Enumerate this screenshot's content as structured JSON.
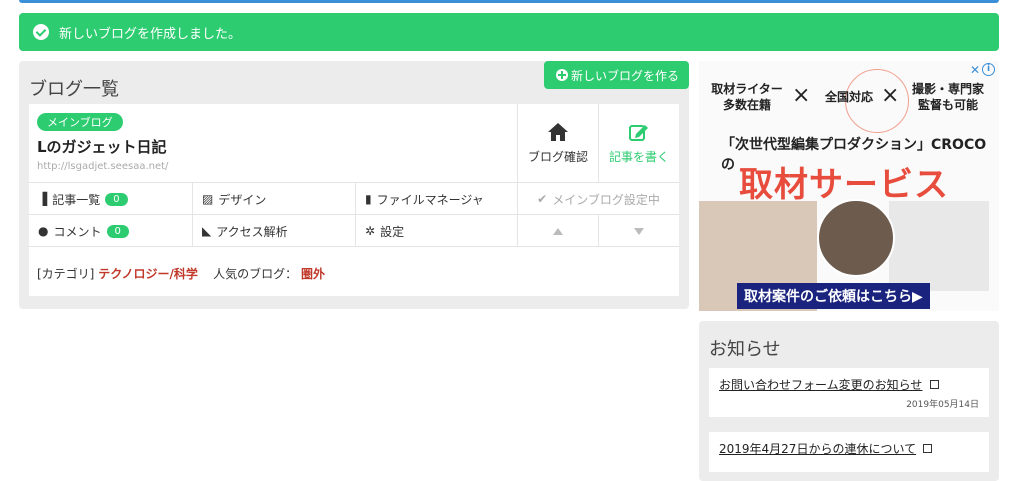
{
  "alert": {
    "message": "新しいブログを作成しました。"
  },
  "panel": {
    "title": "ブログ一覧",
    "new_blog_button": "新しいブログを作る"
  },
  "blog": {
    "badge": "メインブログ",
    "name": "Lのガジェット日記",
    "url": "http://lsgadjet.seesaa.net/",
    "confirm_button": "ブログ確認",
    "write_button": "記事を書く",
    "menu": {
      "articles": "記事一覧",
      "articles_count": "0",
      "design": "デザイン",
      "file_manager": "ファイルマネージャ",
      "main_setting": "メインブログ設定中",
      "comments": "コメント",
      "comments_count": "0",
      "analytics": "アクセス解析",
      "settings": "設定"
    },
    "category_label": "[カテゴリ]",
    "category_value": "テクノロジー/科学",
    "popular_label": "人気のブログ：",
    "popular_value": "圏外"
  },
  "ad": {
    "info": "i",
    "close": "✕",
    "text1a": "取材ライター",
    "text1b": "多数在籍",
    "text2": "全国対応",
    "text3a": "撮影・専門家",
    "text3b": "監督も可能",
    "mult": "×",
    "subtitle": "「次世代型編集プロダクション」CROCOの",
    "headline": "取材サービス",
    "cta": "取材案件のご依頼はこちら▶"
  },
  "notice": {
    "title": "お知らせ",
    "items": [
      {
        "title": "お問い合わせフォーム変更のお知らせ",
        "date": "2019年05月14日"
      },
      {
        "title": "2019年4月27日からの連休について",
        "date": ""
      }
    ]
  },
  "colors": {
    "accent": "#2ecc71",
    "danger": "#c0392b",
    "topbar": "#3a8fd8"
  }
}
